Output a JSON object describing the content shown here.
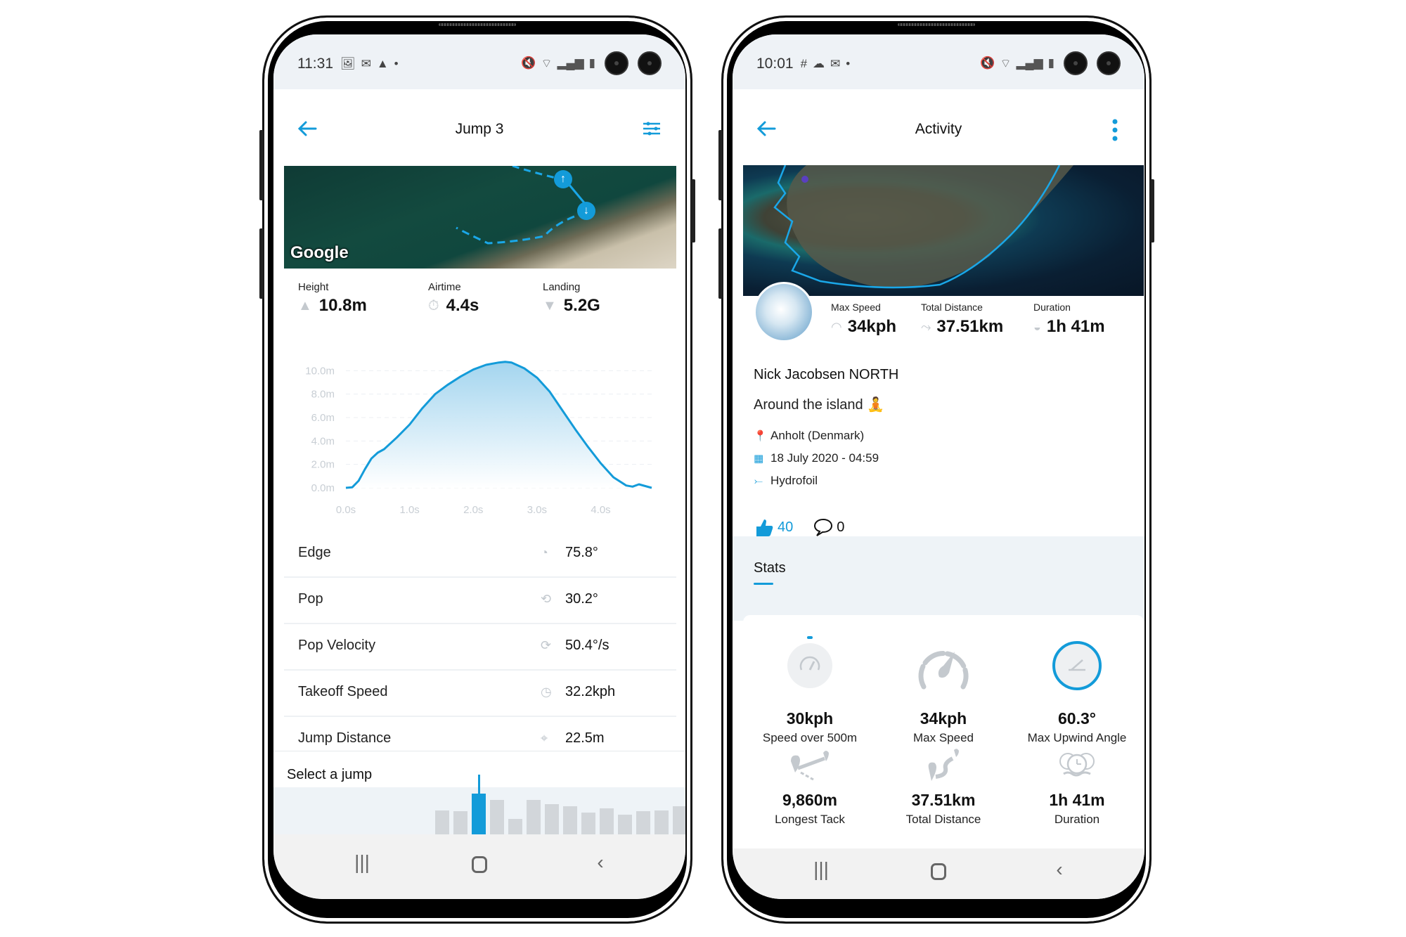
{
  "left_phone": {
    "status_bar": {
      "time": "11:31",
      "left_icons": [
        "gallery-icon",
        "gmail-icon",
        "drive-icon",
        "dot"
      ],
      "right_icons": [
        "mute-icon",
        "wifi-icon",
        "signal-icon",
        "battery-icon"
      ]
    },
    "app_bar": {
      "title": "Jump 3",
      "back_icon": "arrow-left-icon",
      "action_icon": "filter-sliders-icon"
    },
    "map": {
      "attribution": "Google",
      "takeoff_pin": "↑",
      "landing_pin": "↓"
    },
    "jump_stats": [
      {
        "label": "Height",
        "value": "10.8m",
        "icon": "height-icon",
        "glyph": "▲"
      },
      {
        "label": "Airtime",
        "value": "4.4s",
        "icon": "stopwatch-icon",
        "glyph": "⏱"
      },
      {
        "label": "Landing",
        "value": "5.2G",
        "icon": "landing-icon",
        "glyph": "▼"
      }
    ],
    "chart_data": {
      "type": "area",
      "title": "",
      "xlabel": "",
      "ylabel": "",
      "x_ticks": [
        "0.0s",
        "1.0s",
        "2.0s",
        "3.0s",
        "4.0s"
      ],
      "y_ticks": [
        "0.0m",
        "2.0m",
        "4.0m",
        "6.0m",
        "8.0m",
        "10.0m"
      ],
      "xlim": [
        0,
        4.8
      ],
      "ylim": [
        0,
        10.8
      ],
      "grid": true,
      "series": [
        {
          "name": "Height",
          "x": [
            0,
            0.1,
            0.2,
            0.3,
            0.4,
            0.5,
            0.6,
            0.8,
            1.0,
            1.2,
            1.4,
            1.6,
            1.8,
            2.0,
            2.2,
            2.4,
            2.5,
            2.6,
            2.8,
            3.0,
            3.2,
            3.4,
            3.6,
            3.8,
            4.0,
            4.2,
            4.4,
            4.5,
            4.6,
            4.7,
            4.8
          ],
          "y": [
            0,
            0.05,
            0.6,
            1.6,
            2.5,
            3.0,
            3.3,
            4.3,
            5.4,
            6.8,
            8.0,
            8.8,
            9.5,
            10.1,
            10.5,
            10.7,
            10.75,
            10.7,
            10.2,
            9.4,
            8.2,
            6.6,
            5.0,
            3.5,
            2.1,
            0.9,
            0.2,
            0.1,
            0.3,
            0.15,
            0
          ]
        }
      ]
    },
    "metrics": [
      {
        "label": "Edge",
        "value": "75.8°",
        "icon": "edge-angle-icon",
        "glyph": "◔"
      },
      {
        "label": "Pop",
        "value": "30.2°",
        "icon": "pop-icon",
        "glyph": "⟲"
      },
      {
        "label": "Pop Velocity",
        "value": "50.4°/s",
        "icon": "pop-velocity-icon",
        "glyph": "⟳"
      },
      {
        "label": "Takeoff Speed",
        "value": "32.2kph",
        "icon": "speedometer-icon",
        "glyph": "◷"
      },
      {
        "label": "Jump Distance",
        "value": "22.5m",
        "icon": "jump-distance-icon",
        "glyph": "⌖"
      }
    ],
    "jump_selector": {
      "title": "Select a jump",
      "selected_index": 2,
      "bar_heights": [
        0.62,
        0.61,
        0.93,
        0.82,
        0.46,
        0.82,
        0.74,
        0.7,
        0.58,
        0.66,
        0.54,
        0.6,
        0.62,
        0.7
      ]
    },
    "nav_bar": [
      "recents-icon",
      "home-icon",
      "back-icon"
    ]
  },
  "right_phone": {
    "status_bar": {
      "time": "10:01",
      "left_icons": [
        "slack-icon",
        "cloud-icon",
        "gmail-icon",
        "dot"
      ],
      "right_icons": [
        "mute-icon",
        "wifi-icon",
        "signal-icon",
        "battery-icon"
      ]
    },
    "app_bar": {
      "title": "Activity",
      "back_icon": "arrow-left-icon",
      "action_icon": "more-vertical-icon"
    },
    "summary": [
      {
        "label": "Max Speed",
        "value": "34kph",
        "icon": "speedometer-icon",
        "glyph": "◠"
      },
      {
        "label": "Total Distance",
        "value": "37.51km",
        "icon": "route-icon",
        "glyph": "⤳"
      },
      {
        "label": "Duration",
        "value": "1h 41m",
        "icon": "clock-icon",
        "glyph": "◒"
      }
    ],
    "activity": {
      "rider": "Nick Jacobsen NORTH",
      "description": "Around the island 🧘",
      "location": "Anholt (Denmark)",
      "datetime": "18 July 2020 - 04:59",
      "sport": "Hydrofoil",
      "likes": "40",
      "comments": "0"
    },
    "stats_tab": "Stats",
    "stats": [
      {
        "value": "30kph",
        "label": "Speed over 500m",
        "icon": "speed-500m-icon"
      },
      {
        "value": "34kph",
        "label": "Max Speed",
        "icon": "speedometer-icon"
      },
      {
        "value": "60.3°",
        "label": "Max Upwind Angle",
        "icon": "upwind-angle-icon"
      },
      {
        "value": "9,860m",
        "label": "Longest Tack",
        "icon": "longest-tack-icon"
      },
      {
        "value": "37.51km",
        "label": "Total Distance",
        "icon": "total-distance-icon"
      },
      {
        "value": "1h 41m",
        "label": "Duration",
        "icon": "duration-icon"
      }
    ],
    "nav_bar": [
      "recents-icon",
      "home-icon",
      "back-icon"
    ]
  },
  "colors": {
    "accent": "#139bd9",
    "icon_grey": "#c4c9ce",
    "background_grey": "#eef3f7"
  }
}
